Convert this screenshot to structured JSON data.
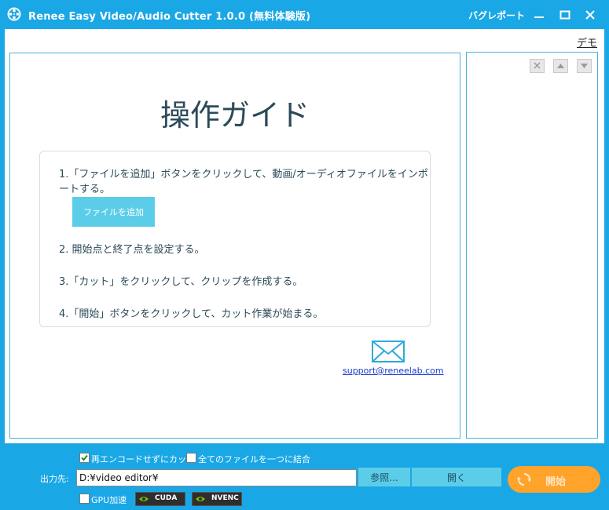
{
  "window": {
    "title": "Renee Easy Video/Audio Cutter 1.0.0 (無料体験版)",
    "bug_report": "バグレポート"
  },
  "demo_link": "デモ",
  "guide": {
    "title": "操作ガイド",
    "steps": [
      "1.「ファイルを追加」ボタンをクリックして、動画/オーディオファイルをインポートする。",
      "2. 開始点と終了点を設定する。",
      "3.「カット」をクリックして、クリップを作成する。",
      "4.「開始」ボタンをクリックして、カット作業が始まる。"
    ],
    "add_file_button": "ファイルを追加",
    "support_email": "support@reneelab.com"
  },
  "footer": {
    "no_reencode_label": "再エンコードせずにカット",
    "no_reencode_checked": true,
    "merge_label": "全てのファイルを一つに結合",
    "merge_checked": false,
    "output_label": "出力先:",
    "output_path": "D:¥video editor¥",
    "browse_button": "参照...",
    "open_button": "開く",
    "gpu_label": "GPU加速",
    "gpu_checked": false,
    "cuda_badge": "CUDA",
    "nvenc_badge": "NVENC",
    "start_button": "開始"
  },
  "colors": {
    "title_bar": "#1aa7e6",
    "panel_border": "#4ab2dc",
    "button_cyan": "#5ccde9",
    "start_orange": "#ffa32a",
    "guide_text": "#2b4a59"
  },
  "icons": {
    "app": "film-reel-icon",
    "minimize": "minimize-icon",
    "maximize": "maximize-icon",
    "close": "close-icon",
    "mail": "mail-icon",
    "delete": "close-icon",
    "move_up": "arrow-up-icon",
    "move_down": "arrow-down-icon",
    "start": "refresh-icon",
    "nvidia": "nvidia-eye-icon"
  }
}
